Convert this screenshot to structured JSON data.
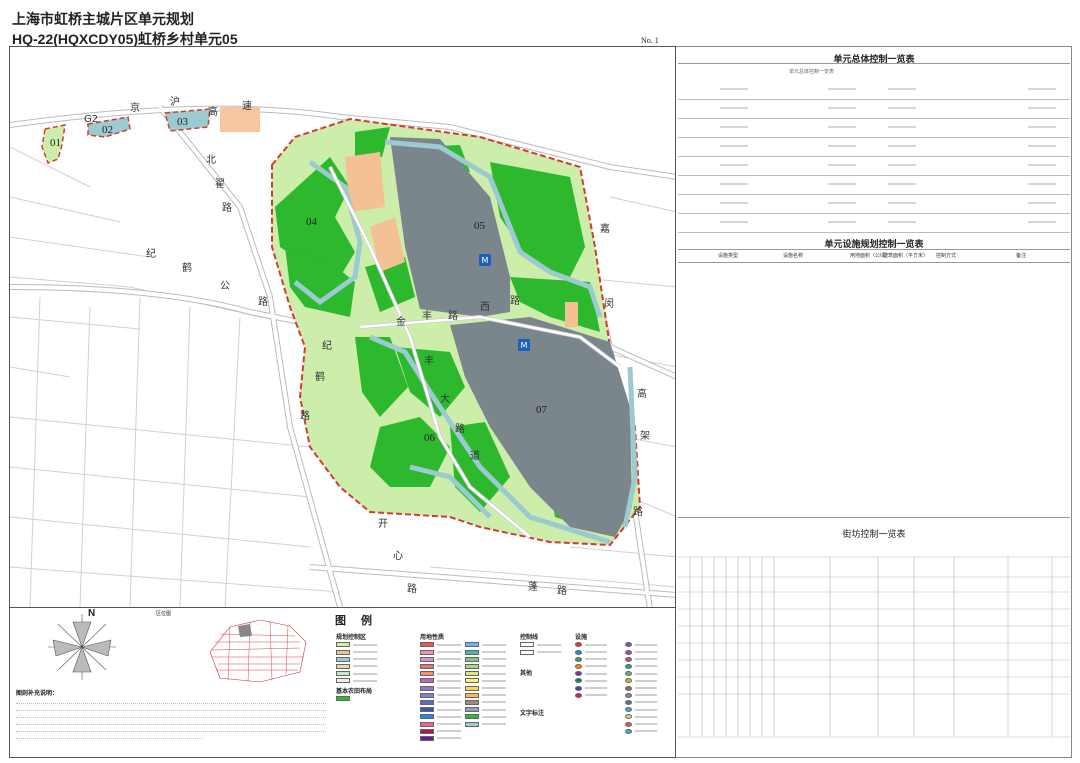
{
  "header": {
    "title": "上海市虹桥主城片区单元规划",
    "subtitle": "HQ-22(HQXCDY05)虹桥乡村单元05",
    "sheet_no": "No. 1"
  },
  "map": {
    "parcels": [
      "01",
      "02",
      "03",
      "04",
      "05",
      "06",
      "07"
    ],
    "road_chars": {
      "g2": "G2",
      "jing": "京",
      "hu": "沪",
      "gao": "高",
      "su": "速",
      "xianxia_1": "纪",
      "xianxia_2": "鹤",
      "xianxia_3": "公",
      "xianxia_4": "路",
      "jinfeng_1": "金",
      "jinfeng_2": "丰",
      "jinfeng_3": "路",
      "jinfeng_4": "西",
      "jinfeng_5": "路",
      "side_1": "嘉",
      "side_2": "闵",
      "side_3": "高",
      "side_4": "架",
      "side_5": "路",
      "left_1": "纪",
      "left_2": "鹤",
      "left_3": "路",
      "down_1": "开",
      "down_2": "心",
      "down_3": "路",
      "bottom_1": "蓬",
      "bottom_2": "路",
      "mid_1": "丰",
      "mid_2": "大",
      "mid_3": "路",
      "mid_4": "道",
      "north_1": "北",
      "north_2": "翟",
      "north_3": "路"
    },
    "colors": {
      "green": "#2db82d",
      "light_green": "#cdeeaa",
      "water": "#9bcad0",
      "grey": "#7b858c",
      "boundary": "#d23b32",
      "road_casing": "#aaaaaa"
    }
  },
  "right_panel": {
    "table1_title": "单元总体控制一览表",
    "table1_sub": "单元总体控制一览表",
    "table2_title": "单元设施规划控制一览表",
    "table2_headers": [
      "设施类型",
      "设施名称",
      "用地面积（公顷）",
      "建筑面积（平方米）",
      "控制方式",
      "备注"
    ],
    "table3_title": "街坊控制一览表"
  },
  "legend": {
    "title": "图 例",
    "compass": "N",
    "location_map": "区位图",
    "section_control": "规划控制区",
    "section_landuse": "用地性质",
    "section_ctrl_lines": "控制线",
    "section_facilities": "设施",
    "section_basic": "基本农田布局",
    "section_lines": "其他",
    "section_text": "文字标注",
    "notes_title": "图则补充说明："
  }
}
